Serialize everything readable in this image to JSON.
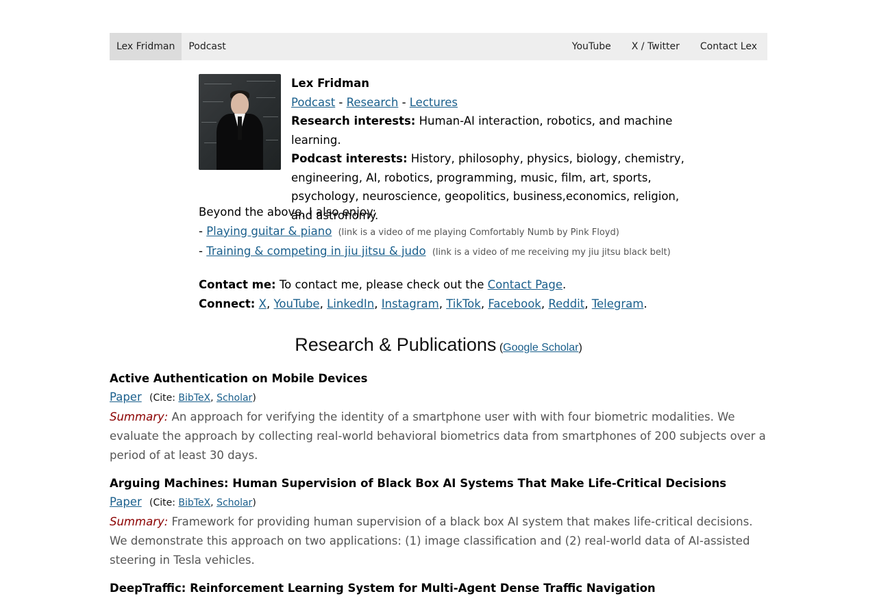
{
  "nav": {
    "left": [
      {
        "label": "Lex Fridman",
        "active": true
      },
      {
        "label": "Podcast",
        "active": false
      }
    ],
    "right": [
      {
        "label": "YouTube"
      },
      {
        "label": "X / Twitter"
      },
      {
        "label": "Contact Lex"
      }
    ]
  },
  "profile": {
    "name": "Lex Fridman",
    "links": [
      "Podcast",
      "Research",
      "Lectures"
    ],
    "sep": " - ",
    "research_label": "Research interests:",
    "research_text": " Human-AI interaction, robotics, and machine learning.",
    "podcast_label": "Podcast interests:",
    "podcast_text": " History, philosophy, physics, biology, chemistry, engineering, AI, robotics, programming, music, film, art, sports, psychology, neuroscience, geopolitics, business,economics, religion, and astronomy."
  },
  "enjoy": {
    "intro": "Beyond the above, I also enjoy:",
    "items": [
      {
        "prefix": "- ",
        "link": "Playing guitar & piano",
        "note": "(link is a video of me playing Comfortably Numb by Pink Floyd)"
      },
      {
        "prefix": "- ",
        "link": "Training & competing in jiu jitsu & judo",
        "note": "(link is a video of me receiving my jiu jitsu black belt)"
      }
    ]
  },
  "contact": {
    "contact_label": "Contact me:",
    "contact_text": " To contact me, please check out the ",
    "contact_link": "Contact Page",
    "contact_end": ".",
    "connect_label": "Connect:",
    "connect_links": [
      "X",
      "YouTube",
      "LinkedIn",
      "Instagram",
      "TikTok",
      "Facebook",
      "Reddit",
      "Telegram"
    ]
  },
  "research": {
    "title": "Research & Publications",
    "paren_open": " (",
    "scholar_link": "Google Scholar",
    "paren_close": ")"
  },
  "pubs": [
    {
      "title": "Active Authentication on Mobile Devices",
      "paper": "Paper",
      "cite_label": "(Cite:",
      "bibtex": "BibTeX",
      "scholar": "Scholar",
      "cite_close": ")",
      "summary_label": "Summary:",
      "summary": " An approach for verifying the identity of a smartphone user with with four biometric modalities. We evaluate the approach by collecting real-world behavioral biometrics data from smartphones of 200 subjects over a period of at least 30 days."
    },
    {
      "title": "Arguing Machines: Human Supervision of Black Box AI Systems That Make Life-Critical Decisions",
      "paper": "Paper",
      "cite_label": "(Cite:",
      "bibtex": "BibTeX",
      "scholar": "Scholar",
      "cite_close": ")",
      "summary_label": "Summary:",
      "summary": " Framework for providing human supervision of a black box AI system that makes life-critical decisions. We demonstrate this approach on two applications: (1) image classification and (2) real-world data of AI-assisted steering in Tesla vehicles."
    },
    {
      "title": "DeepTraffic: Reinforcement Learning System for Multi-Agent Dense Traffic Navigation",
      "paper": "",
      "cite_label": "",
      "bibtex": "",
      "scholar": "",
      "cite_close": "",
      "summary_label": "",
      "summary": ""
    }
  ]
}
